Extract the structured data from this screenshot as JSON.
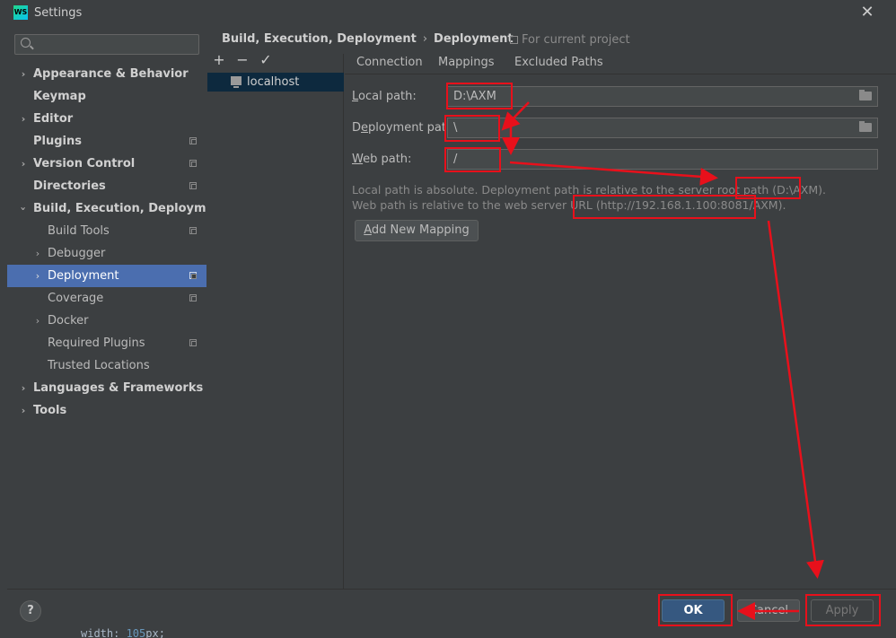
{
  "window": {
    "title": "Settings",
    "logo_text": "WS"
  },
  "search": {
    "placeholder": ""
  },
  "sidebar": {
    "items": [
      {
        "label": "Appearance & Behavior"
      },
      {
        "label": "Keymap"
      },
      {
        "label": "Editor"
      },
      {
        "label": "Plugins"
      },
      {
        "label": "Version Control"
      },
      {
        "label": "Directories"
      },
      {
        "label": "Build, Execution, Deployment"
      },
      {
        "label": "Build Tools"
      },
      {
        "label": "Debugger"
      },
      {
        "label": "Deployment"
      },
      {
        "label": "Coverage"
      },
      {
        "label": "Docker"
      },
      {
        "label": "Required Plugins"
      },
      {
        "label": "Trusted Locations"
      },
      {
        "label": "Languages & Frameworks"
      },
      {
        "label": "Tools"
      }
    ]
  },
  "breadcrumb": {
    "parent": "Build, Execution, Deployment",
    "current": "Deployment",
    "scope": "For current project"
  },
  "servers": {
    "selected": "localhost"
  },
  "tabs": {
    "connection": "Connection",
    "mappings": "Mappings",
    "excluded": "Excluded Paths"
  },
  "mappings": {
    "local_label_u": "L",
    "local_label_rest": "ocal path:",
    "local_value": "D:\\AXM",
    "deploy_label_pre": "D",
    "deploy_label_u": "e",
    "deploy_label_rest": "ployment path:",
    "deploy_value": "\\",
    "web_label_u": "W",
    "web_label_rest": "eb path:",
    "web_value": "/",
    "hint_1": "Local path is absolute. Deployment path is relative to the server root path (D:\\AXM).",
    "hint_2": "Web path is relative to the web server URL (http://192.168.1.100:8081/AXM).",
    "add_button_u": "A",
    "add_button_rest": "dd New Mapping"
  },
  "footer": {
    "help": "?",
    "ok": "OK",
    "cancel": "Cancel",
    "apply": "Apply"
  },
  "code_behind": {
    "text": "width: ",
    "number": "105",
    "unit": "px;"
  },
  "colors": {
    "accent": "#4b6eaf",
    "annotation": "#e8101b"
  }
}
